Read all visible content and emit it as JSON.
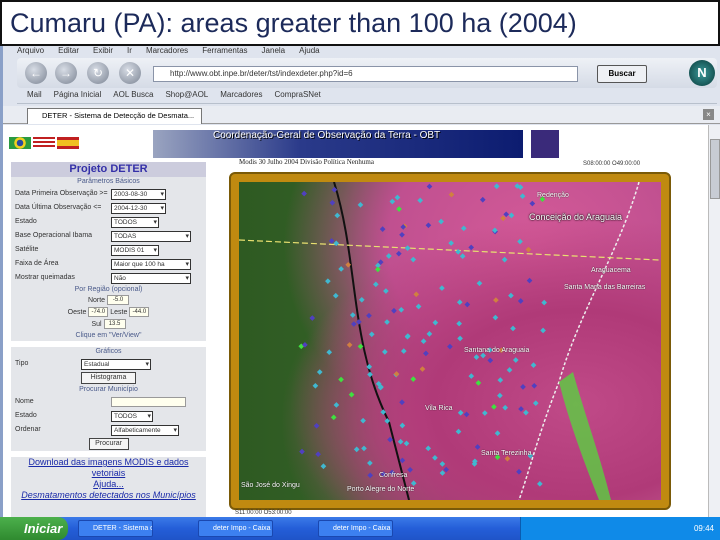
{
  "slide": {
    "title": "Cumaru (PA): areas greater than 100 ha (2004)"
  },
  "browser": {
    "menu": [
      "Arquivo",
      "Editar",
      "Exibir",
      "Ir",
      "Marcadores",
      "Ferramentas",
      "Janela",
      "Ajuda"
    ],
    "url": "http://www.obt.inpe.br/deter/tst/indexdeter.php?id=6",
    "search_label": "Buscar",
    "bookmarks": [
      "Mail",
      "Página Inicial",
      "AOL Busca",
      "Shop@AOL",
      "Marcadores",
      "CompraSNet"
    ],
    "tab_title": "DETER - Sistema de Detecção de Desmata..."
  },
  "page": {
    "banner": "Coordenação-Geral de Observação da Terra - OBT",
    "panel": {
      "title": "Projeto DETER",
      "section_basic": "Parâmetros Básicos",
      "fields": [
        {
          "label": "Data Primeira Observação >=",
          "value": "2003-08-30"
        },
        {
          "label": "Data Última Observação <=",
          "value": "2004-12-30"
        },
        {
          "label": "Estado",
          "value": "TODOS"
        },
        {
          "label": "Base Operacional Ibama",
          "value": "TODAS"
        },
        {
          "label": "Satélite",
          "value": "MODIS 01"
        },
        {
          "label": "Faixa de Área",
          "value": "Maior que 100 ha"
        },
        {
          "label": "Mostrar queimadas",
          "value": "Não"
        }
      ],
      "section_region": "Por Região (opcional)",
      "norte_label": "Norte",
      "norte": "-5.0",
      "oeste_label": "Oeste",
      "oeste": "-74.0",
      "leste_label": "Leste",
      "leste": "-44.0",
      "sul_label": "Sul",
      "sul": "13.5",
      "click_hint": "Clique em \"Ver/View\"",
      "section_graphs": "Gráficos",
      "tipo_label": "Tipo",
      "tipo": "Estadual",
      "histogram_button": "Histograma",
      "section_municipio": "Procurar Município",
      "nome_label": "Nome",
      "nome": "",
      "estado_label": "Estado",
      "estado": "TODOS",
      "ordenar_label": "Ordenar",
      "ordenar": "Alfabeticamente",
      "search_button": "Procurar",
      "download_link": "Download das imagens MODIS e dados vetoriais",
      "help_link": "Ajuda...",
      "desmat_link": "Desmatamentos detectados nos Municípios"
    },
    "map": {
      "header": "Modis 30 Julho 2004 Divisão Política Nenhuma",
      "coord_top": "S08:00:00 O49:00:00",
      "coord_bottom": "S11:00:00 O53:00:00",
      "places": [
        "Redenção",
        "Conceição do Araguaia",
        "Araguacema",
        "Santa Maria das Barreiras",
        "Santana do Araguaia",
        "Vila Rica",
        "Santa Terezinha",
        "Confresa",
        "Porto Alegre do Norte",
        "São José do Xingu"
      ],
      "marker_colors": [
        "#40b8d0",
        "#5040c0",
        "#d08040",
        "#40e040"
      ]
    }
  },
  "taskbar": {
    "start": "Iniciar",
    "tasks": [
      "DETER - Sistema de D...",
      "deter Impo - Caixa d...",
      "deter Impo - Caixa d..."
    ],
    "clock": "09:44"
  }
}
